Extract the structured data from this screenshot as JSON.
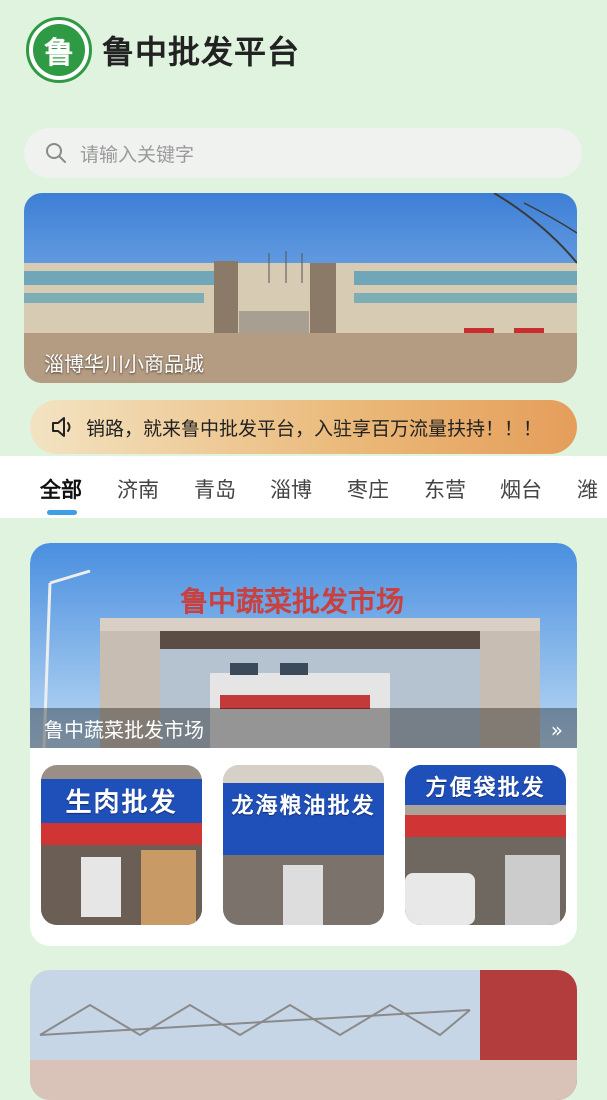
{
  "header": {
    "logo_char": "鲁",
    "title": "鲁中批发平台"
  },
  "search": {
    "placeholder": "请输入关键字",
    "icon": "search-icon"
  },
  "banner": {
    "caption": "淄博华川小商品城"
  },
  "notice": {
    "icon": "speaker-icon",
    "text": "销路，就来鲁中批发平台，入驻享百万流量扶持！！！"
  },
  "tabs": {
    "items": [
      "全部",
      "济南",
      "青岛",
      "淄博",
      "枣庄",
      "东营",
      "烟台",
      "潍"
    ],
    "active": "全部"
  },
  "market_card": {
    "title": "鲁中蔬菜批发市场",
    "more_icon": "double-chevron-right-icon",
    "thumbs": [
      {
        "sign": "生肉批发"
      },
      {
        "sign": "龙海粮油批发"
      },
      {
        "sign": "方便袋批发"
      }
    ]
  },
  "colors": {
    "background": "#dff3df",
    "brand_green": "#2f9a44",
    "tab_indicator": "#3f9ee8"
  }
}
